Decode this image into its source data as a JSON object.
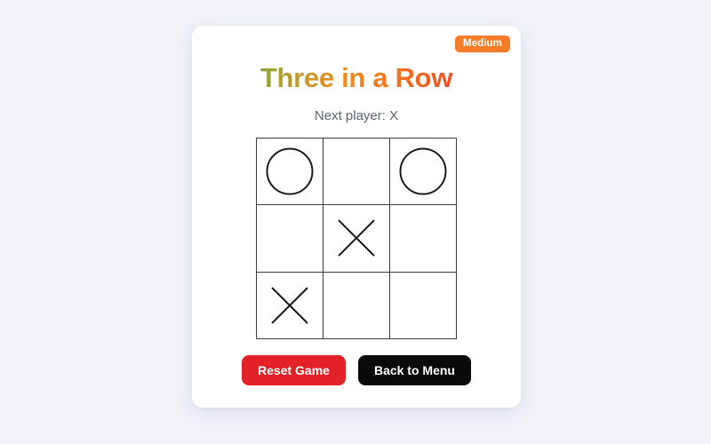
{
  "app": {
    "background_color": "#f1f2f8",
    "card_background": "#ffffff"
  },
  "badge": {
    "label": "Medium",
    "color": "#f57c28",
    "text_color": "#ffffff"
  },
  "header": {
    "title": "Three in a Row",
    "title_gradient_start": "#4aa551",
    "title_gradient_mid": "#f08a1f",
    "title_gradient_end": "#e23c27"
  },
  "status": {
    "text": "Next player: X",
    "color": "#5a6270",
    "next_player": "X"
  },
  "board": {
    "rows": 3,
    "cols": 3,
    "grid_color": "#3c3c3c",
    "mark_color": "#1a1a1a",
    "cells": [
      {
        "index": 0,
        "value": "O",
        "icon": "circle-mark-icon"
      },
      {
        "index": 1,
        "value": "",
        "icon": "empty-cell-icon"
      },
      {
        "index": 2,
        "value": "O",
        "icon": "circle-mark-icon"
      },
      {
        "index": 3,
        "value": "",
        "icon": "empty-cell-icon"
      },
      {
        "index": 4,
        "value": "X",
        "icon": "cross-mark-icon"
      },
      {
        "index": 5,
        "value": "",
        "icon": "empty-cell-icon"
      },
      {
        "index": 6,
        "value": "X",
        "icon": "cross-mark-icon"
      },
      {
        "index": 7,
        "value": "",
        "icon": "empty-cell-icon"
      },
      {
        "index": 8,
        "value": "",
        "icon": "empty-cell-icon"
      }
    ]
  },
  "actions": {
    "reset_label": "Reset Game",
    "reset_color": "#e32227",
    "menu_label": "Back to Menu",
    "menu_color": "#0a0a0a"
  }
}
